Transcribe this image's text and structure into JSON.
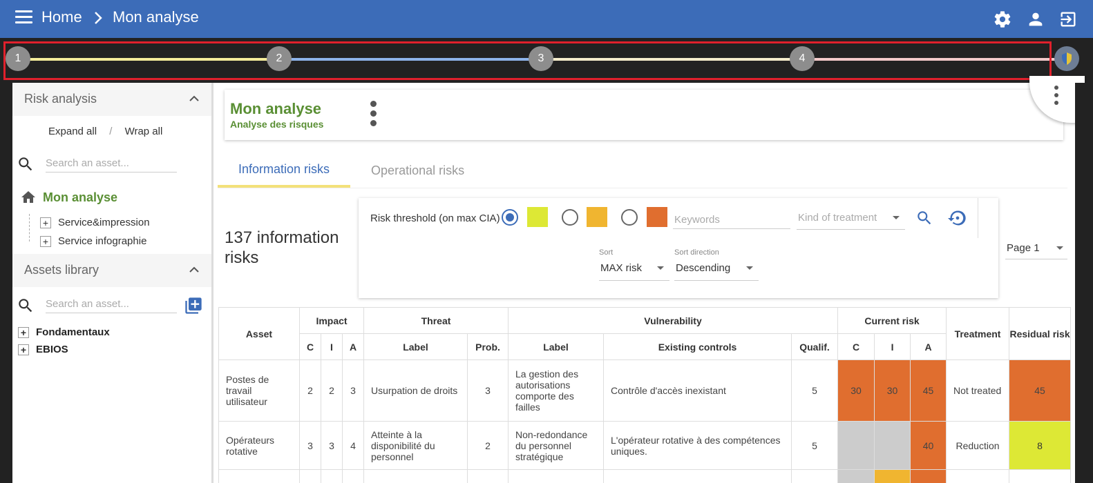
{
  "header": {
    "breadcrumb_home": "Home",
    "breadcrumb_current": "Mon analyse"
  },
  "stepper": {
    "steps": [
      "1",
      "2",
      "3",
      "4"
    ],
    "line_colors": [
      "#f3ec9a",
      "#8db3ea",
      "#f4eccb",
      "#f2c9c9"
    ]
  },
  "sidebar": {
    "risk_analysis_title": "Risk analysis",
    "expand_all": "Expand all",
    "separator": "/",
    "wrap_all": "Wrap all",
    "search_placeholder": "Search an asset...",
    "tree_root": "Mon analyse",
    "tree_items": [
      "Service&impression",
      "Service infographie"
    ],
    "assets_library_title": "Assets library",
    "library_search_placeholder": "Search an asset...",
    "library_items": [
      "Fondamentaux",
      "EBIOS"
    ]
  },
  "analysis": {
    "title": "Mon analyse",
    "subtitle": "Analyse des risques"
  },
  "tabs": {
    "information": "Information risks",
    "operational": "Operational risks"
  },
  "summary": {
    "count_label": "137 information risks"
  },
  "filters": {
    "threshold_label": "Risk threshold (on max CIA)",
    "threshold_colors": [
      "#dde835",
      "#f0b530",
      "#e06e2f"
    ],
    "keywords_placeholder": "Keywords",
    "treatment_placeholder": "Kind of treatment",
    "sort_label": "Sort",
    "sort_value": "MAX risk",
    "direction_label": "Sort direction",
    "direction_value": "Descending",
    "page_value": "Page 1"
  },
  "table": {
    "headers": {
      "asset": "Asset",
      "impact": "Impact",
      "threat": "Threat",
      "vulnerability": "Vulnerability",
      "current_risk": "Current risk",
      "treatment": "Treatment",
      "residual_risk": "Residual risk",
      "c": "C",
      "i": "I",
      "a": "A",
      "label": "Label",
      "prob": "Prob.",
      "existing_controls": "Existing controls",
      "qualif": "Qualif."
    },
    "rows": [
      {
        "asset": "Postes de travail utilisateur",
        "impact_c": "2",
        "impact_i": "2",
        "impact_a": "3",
        "threat_label": "Usurpation de droits",
        "threat_prob": "3",
        "vuln_label": "La gestion des autorisations comporte des failles",
        "controls": "Contrôle d'accès inexistant",
        "qualif": "5",
        "risk_c": "30",
        "risk_i": "30",
        "risk_a": "45",
        "treatment": "Not treated",
        "residual": "45"
      },
      {
        "asset": "Opérateurs rotative",
        "impact_c": "3",
        "impact_i": "3",
        "impact_a": "4",
        "threat_label": "Atteinte à la disponibilité du personnel",
        "threat_prob": "2",
        "vuln_label": "Non-redondance du personnel stratégique",
        "controls": "L'opérateur rotative à des compétences uniques.",
        "qualif": "5",
        "risk_c": "",
        "risk_i": "",
        "risk_a": "40",
        "treatment": "Reduction",
        "residual": "8"
      }
    ]
  },
  "colors": {
    "header_blue": "#3c6cb8",
    "brand_green": "#5a8f34",
    "risk_high": "#e06e2f",
    "risk_low": "#dde835",
    "risk_medium": "#f0b530",
    "risk_none": "#cccccc"
  }
}
